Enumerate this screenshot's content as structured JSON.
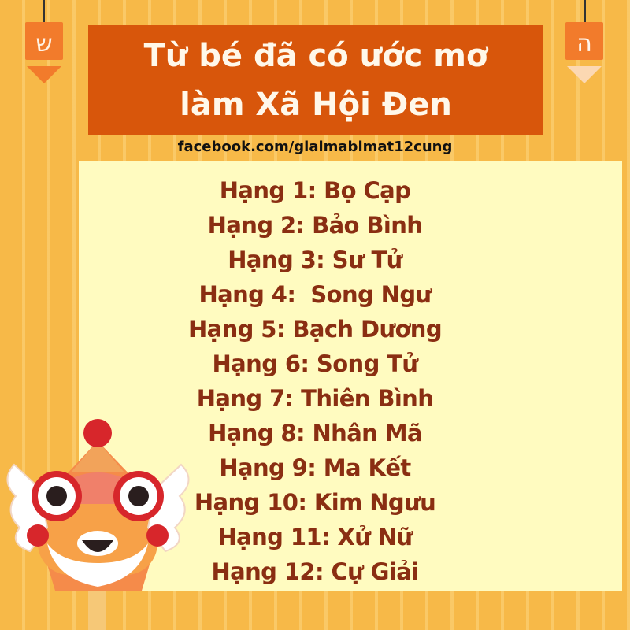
{
  "title": {
    "line1": "Từ bé đã có ước mơ",
    "line2": "làm Xã Hội Đen"
  },
  "facebook_link": "facebook.com/giaimabimat12cung",
  "banners": {
    "left": {
      "glyph": "ש",
      "color": "#f27b2b",
      "glyph_color": "#fff2e4"
    },
    "right": {
      "glyph": "ה",
      "color": "#fcd8b2",
      "glyph_color": "#f07127"
    }
  },
  "ranking": [
    "Hạng 1: Bọ Cạp",
    "Hạng 2: Bảo Bình",
    "Hạng 3: Sư Tử",
    "Hạng 4:  Song Ngư",
    "Hạng 5: Bạch Dương",
    "Hạng 6: Song Tử",
    "Hạng 7: Thiên Bình",
    "Hạng 8: Nhân Mã",
    "Hạng 9: Ma Kết",
    "Hạng 10: Kim Ngưu",
    "Hạng 11: Xử Nữ",
    "Hạng 12: Cự Giải"
  ],
  "colors": {
    "background": "#f7b948",
    "title_box": "#d8560b",
    "list_box": "#fffbc0",
    "list_text": "#8a2e12"
  },
  "icons": [
    "hebrew-shin-banner-icon",
    "hebrew-he-banner-icon",
    "lion-dance-mascot-icon"
  ]
}
